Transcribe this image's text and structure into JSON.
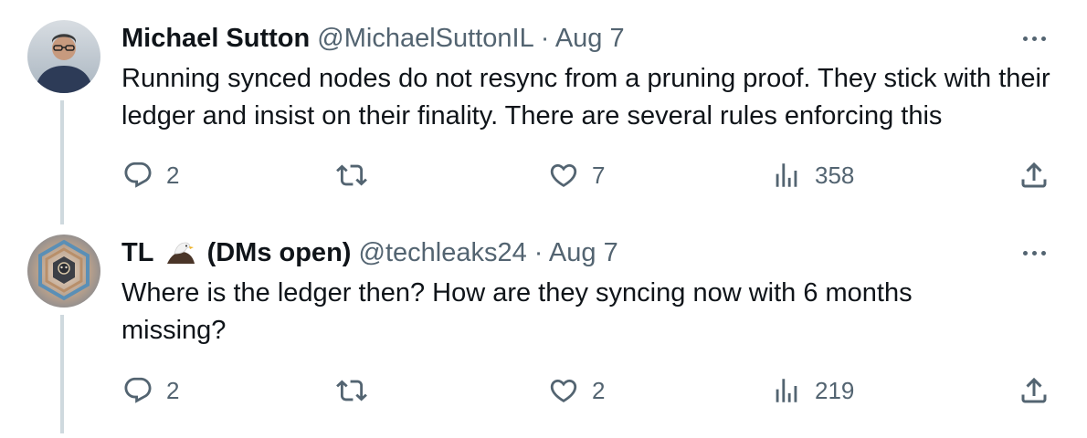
{
  "tweets": [
    {
      "author_name": "Michael Sutton",
      "handle": "@MichaelSuttonIL",
      "separator": "·",
      "date": "Aug 7",
      "text": "Running synced nodes do not resync from a pruning proof. They stick with their ledger and insist on their finality. There are several rules enforcing this",
      "replies": "2",
      "retweets": "",
      "likes": "7",
      "views": "358",
      "avatar_icon": "user-photo-avatar"
    },
    {
      "author_name": "TL",
      "author_suffix": "(DMs open)",
      "name_emoji": "eagle",
      "handle": "@techleaks24",
      "separator": "·",
      "date": "Aug 7",
      "text": "Where is the ledger then? How are they syncing now with 6 months missing?",
      "replies": "2",
      "retweets": "",
      "likes": "2",
      "views": "219",
      "avatar_icon": "hexagon-cube-avatar"
    }
  ],
  "colors": {
    "text_primary": "#0f1419",
    "text_secondary": "#536471",
    "thread_line": "#cfd9de",
    "background": "#ffffff"
  }
}
